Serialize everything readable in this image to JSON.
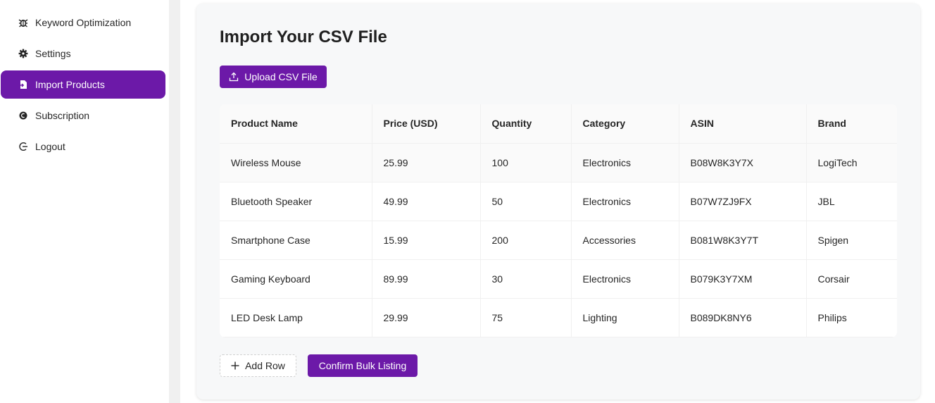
{
  "sidebar": {
    "items": [
      {
        "label": "Keyword Optimization",
        "icon": "bug-icon"
      },
      {
        "label": "Settings",
        "icon": "gear-icon"
      },
      {
        "label": "Import Products",
        "icon": "file-import-icon",
        "active": true
      },
      {
        "label": "Subscription",
        "icon": "coin-icon"
      },
      {
        "label": "Logout",
        "icon": "logout-icon"
      }
    ]
  },
  "main": {
    "title": "Import Your CSV File",
    "upload_label": "Upload CSV File",
    "table": {
      "headers": [
        "Product Name",
        "Price (USD)",
        "Quantity",
        "Category",
        "ASIN",
        "Brand"
      ],
      "rows": [
        [
          "Wireless Mouse",
          "25.99",
          "100",
          "Electronics",
          "B08W8K3Y7X",
          "LogiTech"
        ],
        [
          "Bluetooth Speaker",
          "49.99",
          "50",
          "Electronics",
          "B07W7ZJ9FX",
          "JBL"
        ],
        [
          "Smartphone Case",
          "15.99",
          "200",
          "Accessories",
          "B081W8K3Y7T",
          "Spigen"
        ],
        [
          "Gaming Keyboard",
          "89.99",
          "30",
          "Electronics",
          "B079K3Y7XM",
          "Corsair"
        ],
        [
          "LED Desk Lamp",
          "29.99",
          "75",
          "Lighting",
          "B089DK8NY6",
          "Philips"
        ]
      ]
    },
    "add_row_label": "Add Row",
    "confirm_label": "Confirm Bulk Listing"
  },
  "colors": {
    "accent": "#6c19a8",
    "text": "#262626",
    "card_bg": "#f7f8f9"
  }
}
